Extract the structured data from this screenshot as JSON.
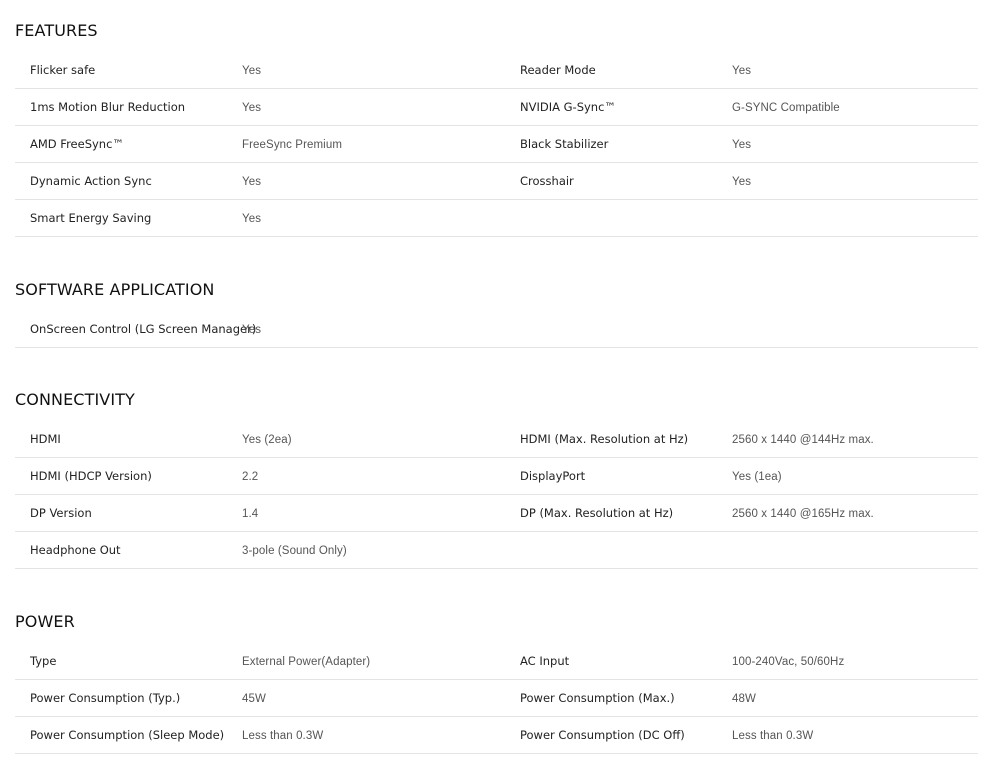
{
  "sections": [
    {
      "title": "FEATURES",
      "rows": [
        {
          "l1": "Flicker safe",
          "v1": "Yes",
          "l2": "Reader Mode",
          "v2": "Yes"
        },
        {
          "l1": "1ms Motion Blur Reduction",
          "v1": "Yes",
          "l2": "NVIDIA G-Sync™",
          "v2": "G-SYNC Compatible"
        },
        {
          "l1": "AMD FreeSync™",
          "v1": "FreeSync Premium",
          "l2": "Black Stabilizer",
          "v2": "Yes"
        },
        {
          "l1": "Dynamic Action Sync",
          "v1": "Yes",
          "l2": "Crosshair",
          "v2": "Yes"
        },
        {
          "l1": "Smart Energy Saving",
          "v1": "Yes",
          "l2": "",
          "v2": ""
        }
      ]
    },
    {
      "title": "SOFTWARE APPLICATION",
      "rows": [
        {
          "l1": "OnScreen Control (LG Screen Manager)",
          "v1": "Yes",
          "l2": "",
          "v2": ""
        }
      ]
    },
    {
      "title": "CONNECTIVITY",
      "rows": [
        {
          "l1": "HDMI",
          "v1": "Yes (2ea)",
          "l2": "HDMI (Max. Resolution at Hz)",
          "v2": "2560 x 1440 @144Hz max."
        },
        {
          "l1": "HDMI (HDCP Version)",
          "v1": "2.2",
          "l2": "DisplayPort",
          "v2": "Yes (1ea)"
        },
        {
          "l1": "DP Version",
          "v1": "1.4",
          "l2": "DP (Max. Resolution at Hz)",
          "v2": "2560 x 1440 @165Hz max."
        },
        {
          "l1": "Headphone Out",
          "v1": "3-pole (Sound Only)",
          "l2": "",
          "v2": ""
        }
      ]
    },
    {
      "title": "POWER",
      "rows": [
        {
          "l1": "Type",
          "v1": "External Power(Adapter)",
          "l2": "AC Input",
          "v2": "100-240Vac, 50/60Hz"
        },
        {
          "l1": "Power Consumption (Typ.)",
          "v1": "45W",
          "l2": "Power Consumption (Max.)",
          "v2": "48W"
        },
        {
          "l1": "Power Consumption (Sleep Mode)",
          "v1": "Less than 0.3W",
          "l2": "Power Consumption (DC Off)",
          "v2": "Less than 0.3W"
        }
      ]
    }
  ]
}
